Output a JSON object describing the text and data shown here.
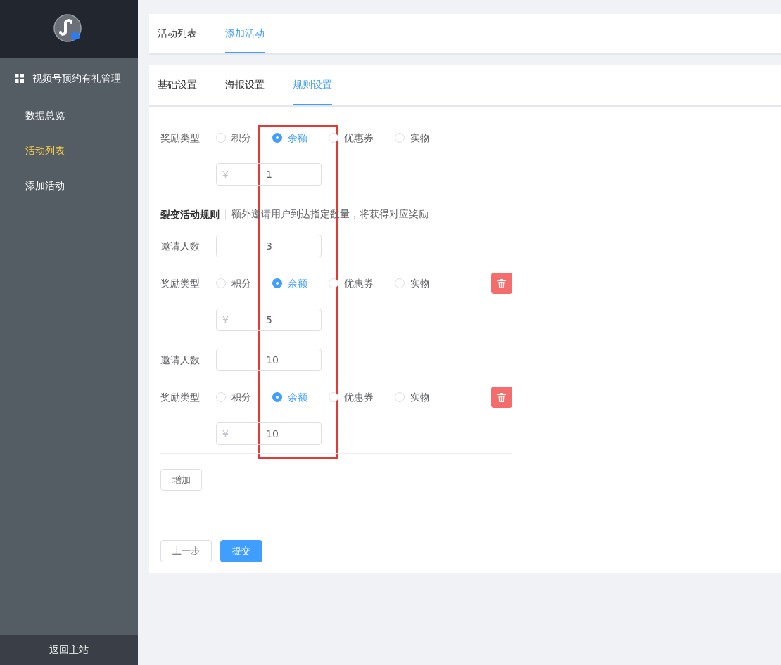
{
  "sidebar": {
    "title": "视频号预约有礼管理",
    "items": [
      {
        "label": "数据总览",
        "selected": false
      },
      {
        "label": "活动列表",
        "selected": true
      },
      {
        "label": "添加活动",
        "selected": false
      }
    ],
    "footer": "返回主站"
  },
  "top_tabs": [
    {
      "label": "活动列表",
      "selected": false
    },
    {
      "label": "添加活动",
      "selected": true
    }
  ],
  "sub_tabs": [
    {
      "label": "基础设置",
      "selected": false
    },
    {
      "label": "海报设置",
      "selected": false
    },
    {
      "label": "规则设置",
      "selected": true
    }
  ],
  "reward": {
    "label": "奖励类型",
    "options": [
      {
        "label": "积分",
        "selected": false
      },
      {
        "label": "余额",
        "selected": true
      },
      {
        "label": "优惠券",
        "selected": false
      },
      {
        "label": "实物",
        "selected": false
      }
    ],
    "amount": {
      "prefix": "¥",
      "value": "1"
    }
  },
  "fission": {
    "title": "裂变活动规则",
    "hint": "额外邀请用户到达指定数量，将获得对应奖励",
    "tiers": [
      {
        "invite_label": "邀请人数",
        "invite_value": "3",
        "reward_label": "奖励类型",
        "options": [
          {
            "label": "积分",
            "selected": false
          },
          {
            "label": "余额",
            "selected": true
          },
          {
            "label": "优惠券",
            "selected": false
          },
          {
            "label": "实物",
            "selected": false
          }
        ],
        "amount": {
          "prefix": "¥",
          "value": "5"
        }
      },
      {
        "invite_label": "邀请人数",
        "invite_value": "10",
        "reward_label": "奖励类型",
        "options": [
          {
            "label": "积分",
            "selected": false
          },
          {
            "label": "余额",
            "selected": true
          },
          {
            "label": "优惠券",
            "selected": false
          },
          {
            "label": "实物",
            "selected": false
          }
        ],
        "amount": {
          "prefix": "¥",
          "value": "10"
        }
      }
    ]
  },
  "add_button": "增加",
  "buttons": [
    {
      "label": "上一步",
      "kind": "default"
    },
    {
      "label": "提交",
      "kind": "primary"
    }
  ]
}
